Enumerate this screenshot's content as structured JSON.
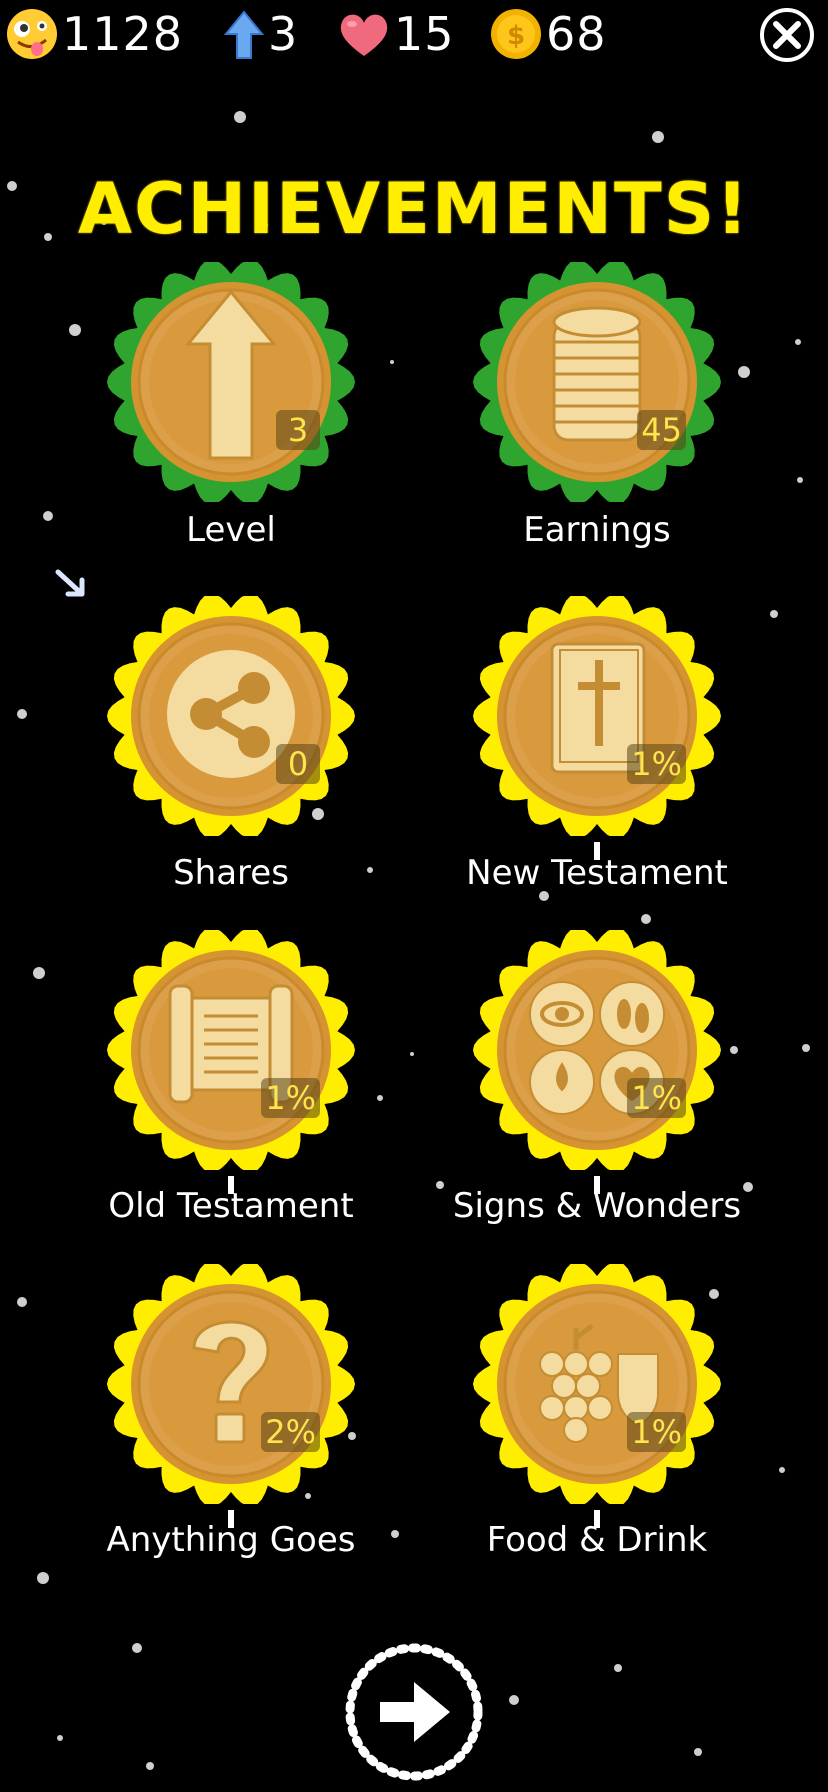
{
  "stats": {
    "score": {
      "icon": "crazy-face-emoji-icon",
      "value": "1128"
    },
    "level": {
      "icon": "blue-up-arrow-icon",
      "value": "3"
    },
    "lives": {
      "icon": "heart-icon",
      "value": "15"
    },
    "coins": {
      "icon": "gold-coin-icon",
      "value": "68"
    }
  },
  "title": "ACHIEVEMENTS!",
  "colors": {
    "title": "#ffee00",
    "ring_complete": "#2fa52f",
    "ring_progress": "#ffee00",
    "medal": "#d79a35"
  },
  "badges": [
    {
      "label": "Level",
      "count": "3",
      "icon": "up-arrow-icon",
      "ring": "green"
    },
    {
      "label": "Earnings",
      "count": "45",
      "icon": "coin-stack-icon",
      "ring": "green"
    },
    {
      "label": "Shares",
      "count": "0",
      "icon": "share-icon",
      "ring": "yellow"
    },
    {
      "label": "New Testament",
      "count": "1%",
      "icon": "bible-cross-icon",
      "ring": "yellow"
    },
    {
      "label": "Old Testament",
      "count": "1%",
      "icon": "scroll-icon",
      "ring": "yellow"
    },
    {
      "label": "Signs & Wonders",
      "count": "1%",
      "icon": "signs-wonders-icon",
      "ring": "yellow"
    },
    {
      "label": "Anything Goes",
      "count": "2%",
      "icon": "question-mark-icon",
      "ring": "yellow"
    },
    {
      "label": "Food & Drink",
      "count": "1%",
      "icon": "grapes-cup-icon",
      "ring": "yellow"
    }
  ]
}
